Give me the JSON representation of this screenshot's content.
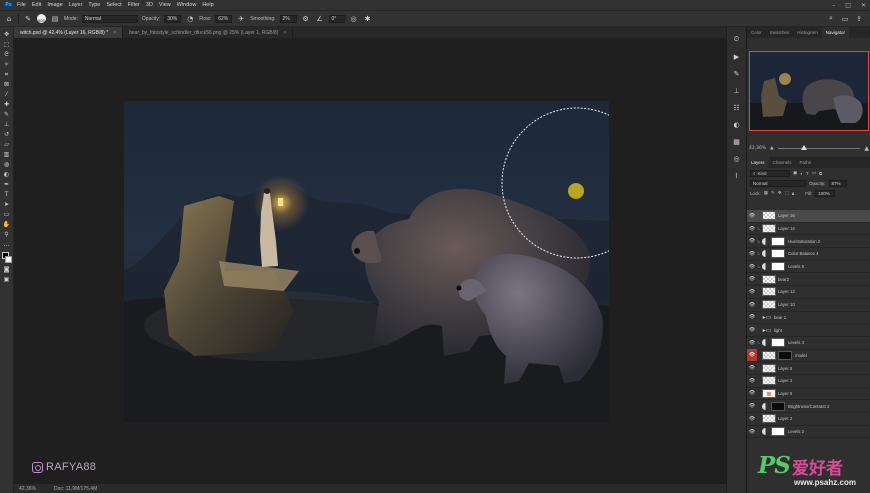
{
  "menu": [
    "File",
    "Edit",
    "Image",
    "Layer",
    "Type",
    "Select",
    "Filter",
    "3D",
    "View",
    "Window",
    "Help"
  ],
  "options": {
    "brush_size": "900",
    "mode_label": "Mode:",
    "mode_value": "Normal",
    "opacity_label": "Opacity:",
    "opacity_value": "30%",
    "flow_label": "Flow:",
    "flow_value": "62%",
    "smoothing_label": "Smoothing:",
    "smoothing_value": "2%",
    "angle_value": "0°"
  },
  "tabs": [
    {
      "label": "witch.psd @ 42,4% (Layer 16, RGB/8) *"
    },
    {
      "label": "bear_by_fotostyle_schindler_dfuck56.png @ 25% (Layer 1, RGB/8)"
    }
  ],
  "status": {
    "zoom": "42,36%",
    "doc": "Doc: 11,9M/175,4M"
  },
  "watermark_text": "RAFYA88",
  "panels": {
    "top_tabs": [
      "Color",
      "Swatches",
      "Histogram",
      "Navigator"
    ],
    "zoom": "42,36%",
    "layer_tabs": [
      "Layers",
      "Channels",
      "Paths"
    ],
    "filter_kind": "Kind",
    "blend_mode": "Normal",
    "opacity_label": "Opacity:",
    "opacity_value": "87%",
    "lock_label": "Lock:",
    "fill_label": "Fill:",
    "fill_value": "100%",
    "layers": [
      {
        "name": "Layer 16",
        "thumb": "checker",
        "mask": "",
        "adj": false,
        "clip": false,
        "selected": true,
        "eye_red": false
      },
      {
        "name": "Layer 14",
        "thumb": "checker",
        "mask": "",
        "adj": false,
        "clip": true,
        "selected": false,
        "eye_red": false
      },
      {
        "name": "Hue/Saturation 2",
        "thumb": "",
        "mask": "white",
        "adj": true,
        "clip": true,
        "selected": false,
        "eye_red": false
      },
      {
        "name": "Color Balance 4",
        "thumb": "",
        "mask": "white",
        "adj": true,
        "clip": true,
        "selected": false,
        "eye_red": false
      },
      {
        "name": "Levels 5",
        "thumb": "",
        "mask": "white",
        "adj": true,
        "clip": true,
        "selected": false,
        "eye_red": false
      },
      {
        "name": "bear2",
        "thumb": "checker",
        "mask": "",
        "adj": false,
        "clip": false,
        "selected": false,
        "eye_red": false
      },
      {
        "name": "Layer 13",
        "thumb": "checker",
        "mask": "",
        "adj": false,
        "clip": false,
        "selected": false,
        "eye_red": false
      },
      {
        "name": "Layer 10",
        "thumb": "checker",
        "mask": "",
        "adj": false,
        "clip": false,
        "selected": false,
        "eye_red": false
      },
      {
        "name": "bear 1",
        "thumb": "folder",
        "mask": "",
        "adj": false,
        "clip": false,
        "selected": false,
        "eye_red": false
      },
      {
        "name": "light",
        "thumb": "folder",
        "mask": "",
        "adj": false,
        "clip": false,
        "selected": false,
        "eye_red": false
      },
      {
        "name": "Levels 3",
        "thumb": "",
        "mask": "white",
        "adj": true,
        "clip": true,
        "selected": false,
        "eye_red": false
      },
      {
        "name": "model",
        "thumb": "checker",
        "mask": "dark",
        "adj": false,
        "clip": false,
        "selected": false,
        "eye_red": true
      },
      {
        "name": "Layer 5",
        "thumb": "checker",
        "mask": "",
        "adj": false,
        "clip": false,
        "selected": false,
        "eye_red": false
      },
      {
        "name": "Layer 3",
        "thumb": "checker",
        "mask": "",
        "adj": false,
        "clip": false,
        "selected": false,
        "eye_red": false
      },
      {
        "name": "Layer 6",
        "thumb": "orange",
        "mask": "",
        "adj": false,
        "clip": false,
        "selected": false,
        "eye_red": false
      },
      {
        "name": "Brightness/Contrast 2",
        "thumb": "",
        "mask": "dark",
        "adj": true,
        "clip": false,
        "selected": false,
        "eye_red": false
      },
      {
        "name": "Layer 2",
        "thumb": "checker",
        "mask": "",
        "adj": false,
        "clip": false,
        "selected": false,
        "eye_red": false
      },
      {
        "name": "Levels 2",
        "thumb": "",
        "mask": "white",
        "adj": true,
        "clip": false,
        "selected": false,
        "eye_red": false
      }
    ]
  },
  "site_watermark": {
    "logo": "PS",
    "cn": "爱好者",
    "url": "www.psahz.com"
  },
  "colors": {
    "accent_red": "#e0483e",
    "eye_red": "#b3362f",
    "brush_yellow": "#c9b21e"
  }
}
